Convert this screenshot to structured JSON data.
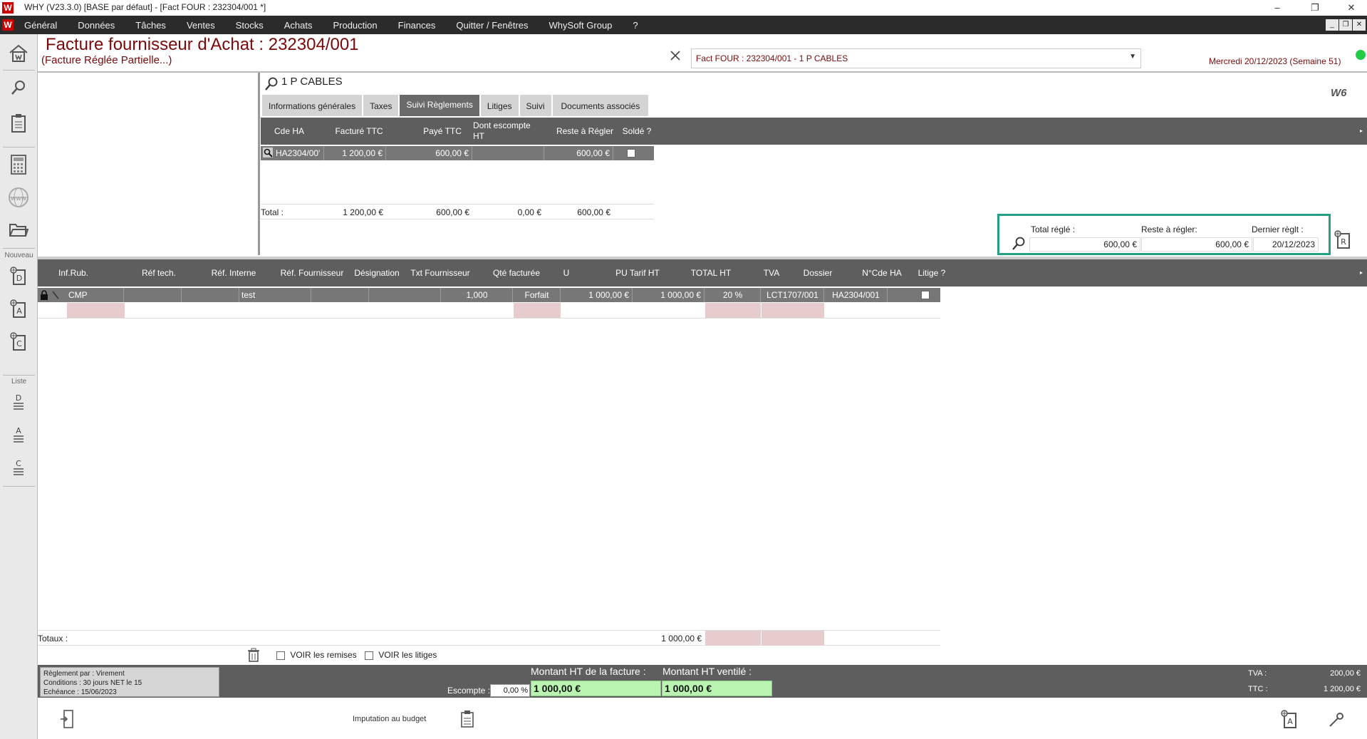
{
  "window": {
    "app_icon": "W",
    "title": "WHY (V23.3.0)  [BASE par défaut] - [Fact FOUR : 232304/001 *]",
    "minimize": "–",
    "maximize": "❐",
    "close": "✕",
    "mdi_minimize": "_",
    "mdi_restore": "❐",
    "mdi_close": "✕"
  },
  "menu": {
    "items": [
      "Général",
      "Données",
      "Tâches",
      "Ventes",
      "Stocks",
      "Achats",
      "Production",
      "Finances",
      "Quitter / Fenêtres",
      "WhySoft Group",
      "?"
    ]
  },
  "sidebar": {
    "nouveau_label": "Nouveau",
    "liste_label": "Liste",
    "icon_letters": [
      "D",
      "A",
      "C"
    ]
  },
  "header": {
    "title": "Facture fournisseur d'Achat  : 232304/001",
    "status": "(Facture Réglée Partielle...)",
    "document_select": "Fact FOUR : 232304/001 - 1 P CABLES",
    "date": "Mercredi 20/12/2023 (Semaine 51)",
    "brand_mark": "W6"
  },
  "supplier": {
    "name": "1 P CABLES"
  },
  "tabs": [
    {
      "label": "Informations générales",
      "active": false
    },
    {
      "label": "Taxes",
      "active": false
    },
    {
      "label": "Suivi Règlements",
      "active": true
    },
    {
      "label": "Litiges",
      "active": false
    },
    {
      "label": "Suivi",
      "active": false
    },
    {
      "label": "Documents associés",
      "active": false
    }
  ],
  "suivi_grid": {
    "headers": {
      "cde": "Cde HA",
      "facture": "Facturé TTC",
      "paye": "Payé TTC",
      "escompte": "Dont escompte HT",
      "reste": "Reste à Régler",
      "solde": "Soldé ?"
    },
    "row": {
      "cde": "HA2304/00'",
      "facture": "1 200,00 €",
      "paye": "600,00 €",
      "escompte": "",
      "reste": "600,00 €"
    },
    "total": {
      "label": "Total :",
      "facture": "1 200,00 €",
      "paye": "600,00 €",
      "escompte": "0,00 €",
      "reste": "600,00 €"
    }
  },
  "summary": {
    "total_regle_label": "Total réglé :",
    "total_regle": "600,00 €",
    "reste_label": "Reste à régler:",
    "reste": "600,00 €",
    "dernier_label": "Dernier règlt :",
    "dernier": "20/12/2023",
    "side_icon_letter": "R"
  },
  "lines_grid": {
    "headers": {
      "inf": "Inf.Rub.",
      "reftech": "Réf tech.",
      "refint": "Réf. Interne",
      "reffour": "Réf. Fournisseur",
      "desig": "Désignation",
      "txt": "Txt Fournisseur",
      "qte": "Qté facturée",
      "u": "U",
      "pu": "PU Tarif HT",
      "total": "TOTAL HT",
      "tva": "TVA",
      "dossier": "Dossier",
      "ncde": "N°Cde HA",
      "litige": "Litige ?"
    },
    "row": {
      "inf": "CMP",
      "reffour": "test",
      "qte": "1,000",
      "u": "Forfait",
      "pu": "1 000,00 €",
      "total": "1 000,00 €",
      "tva": "20 %",
      "dossier": "LCT1707/001",
      "ncde": "HA2304/001"
    },
    "totaux_label": "Totaux :",
    "totaux_ht": "1 000,00 €"
  },
  "options": {
    "voir_remises": "VOIR les remises",
    "voir_litiges": "VOIR les litiges"
  },
  "footer": {
    "reglement": "Règlement par : Virement",
    "conditions": "Conditions : 30 jours NET le 15",
    "echeance": "Echéance : 15/06/2023",
    "escompte_label": "Escompte :",
    "escompte_value": "0,00 %",
    "montant_ht_label": "Montant HT de la facture :",
    "montant_ht": "1 000,00 €",
    "montant_ventile_label": "Montant HT ventilé :",
    "montant_ventile": "1 000,00 €",
    "tva_label": "TVA :",
    "tva": "200,00 €",
    "ttc_label": "TTC :",
    "ttc": "1 200,00 €"
  },
  "bottom": {
    "imputation_label": "Imputation au budget",
    "doc_icon_letter": "A"
  }
}
